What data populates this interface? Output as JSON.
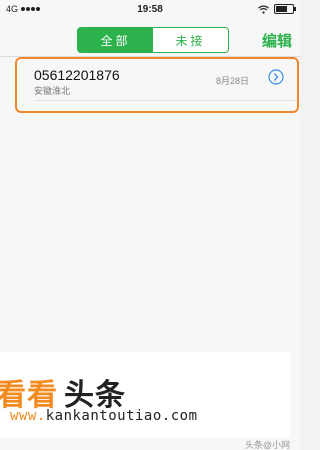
{
  "status_bar": {
    "carrier": "4G",
    "time": "19:58"
  },
  "nav": {
    "segments": [
      {
        "label": "全部",
        "active": true
      },
      {
        "label": "未接",
        "active": false
      }
    ],
    "edit_label": "编辑"
  },
  "calls": [
    {
      "number": "05612201876",
      "location": "安徽淮北",
      "date": "8月28日",
      "icon": "info-circle-icon"
    }
  ],
  "watermark": {
    "brand_orange": "看看",
    "brand_black": "头条",
    "url_prefix": "www.",
    "url_main": "kankantoutiao.com",
    "credit": "头条@小网"
  },
  "colors": {
    "accent_green": "#2bb24c",
    "highlight_orange": "#f0872a",
    "info_blue": "#3a8ee6"
  }
}
